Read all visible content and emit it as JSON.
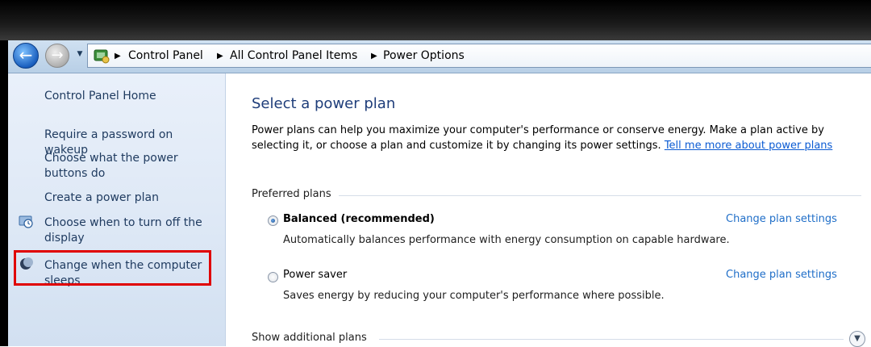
{
  "breadcrumb": {
    "items": [
      "Control Panel",
      "All Control Panel Items",
      "Power Options"
    ]
  },
  "icons": {
    "back": "back-arrow-icon",
    "forward": "forward-arrow-icon",
    "dropdown": "chevron-down-icon",
    "location": "control-panel-icon",
    "display": "display-clock-icon",
    "sleep": "moon-icon",
    "expand": "chevron-down-circle-icon"
  },
  "sidebar": {
    "items": [
      {
        "label": "Control Panel Home"
      },
      {
        "label": "Require a password on wakeup"
      },
      {
        "label": "Choose what the power buttons do"
      },
      {
        "label": "Create a power plan"
      },
      {
        "label": "Choose when to turn off the display"
      },
      {
        "label": "Change when the computer sleeps"
      }
    ]
  },
  "main": {
    "title": "Select a power plan",
    "intro_text": "Power plans can help you maximize your computer's performance or conserve energy. Make a plan active by selecting it, or choose a plan and customize it by changing its power settings. ",
    "intro_link": "Tell me more about power plans",
    "preferred_label": "Preferred plans",
    "plans": [
      {
        "name": "Balanced (recommended)",
        "selected": true,
        "description": "Automatically balances performance with energy consumption on capable hardware.",
        "link": "Change plan settings"
      },
      {
        "name": "Power saver",
        "selected": false,
        "description": "Saves energy by reducing your computer's performance where possible.",
        "link": "Change plan settings"
      }
    ],
    "show_additional": "Show additional plans"
  },
  "colors": {
    "highlight": "#e00000",
    "link": "#1f6ec8",
    "title": "#1e3d7a"
  }
}
